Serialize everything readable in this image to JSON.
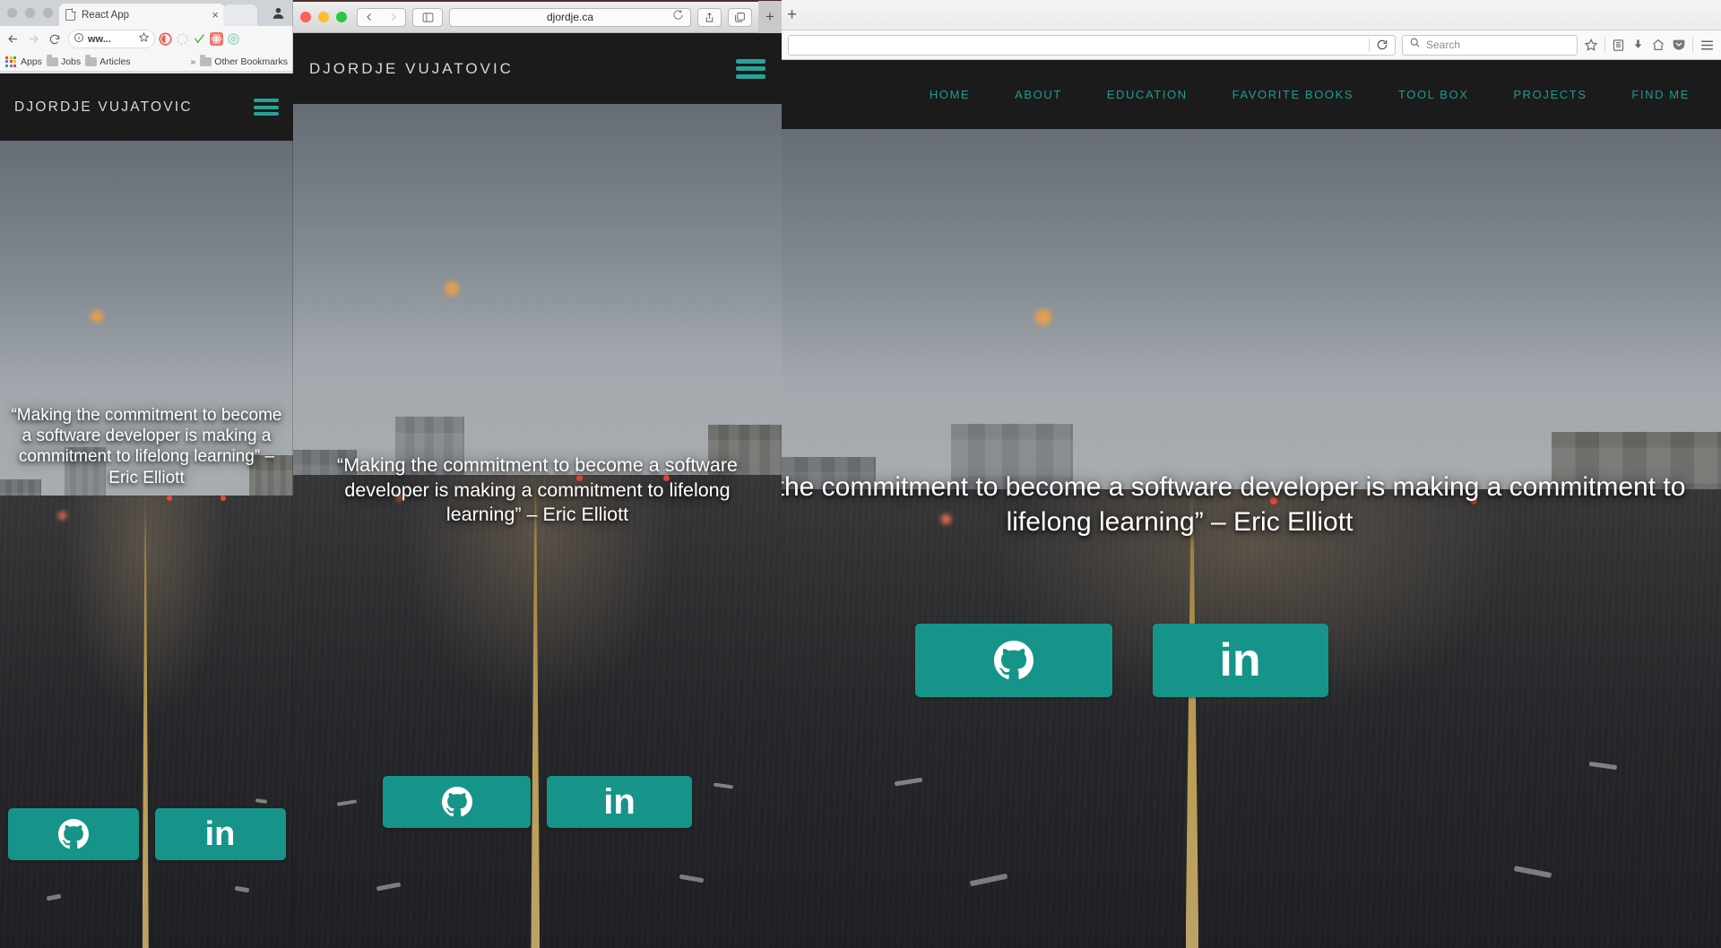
{
  "site": {
    "logo": "DJORDJE VUJATOVIC",
    "menu_icon": "hamburger-menu-icon",
    "accent_color": "#1f9b91",
    "button_color": "#16948a",
    "header_bg": "#1b1b1b",
    "quote": "“Making the commitment to become a software developer is making a commitment to lifelong learning” – Eric Elliott",
    "nav_items": [
      {
        "label": "HOME"
      },
      {
        "label": "ABOUT"
      },
      {
        "label": "EDUCATION"
      },
      {
        "label": "FAVORITE BOOKS"
      },
      {
        "label": "TOOL BOX"
      },
      {
        "label": "PROJECTS"
      },
      {
        "label": "FIND ME"
      }
    ],
    "social": [
      {
        "name": "github-button",
        "icon": "github-icon",
        "label": ""
      },
      {
        "name": "linkedin-button",
        "icon": "linkedin-icon",
        "label": "in"
      }
    ]
  },
  "chrome_window": {
    "tab_title": "React App",
    "tab_close": "×",
    "omnibox_value": "ww...",
    "info_icon": "info-circle-icon",
    "star_icon": "bookmark-star-icon",
    "back_icon": "back-arrow-icon",
    "forward_icon": "forward-arrow-icon",
    "reload_icon": "reload-icon",
    "profile_icon": "profile-avatar-icon",
    "bookmarks": [
      {
        "label": "Apps",
        "icon": "apps-grid-icon"
      },
      {
        "label": "Jobs",
        "icon": "folder-icon"
      },
      {
        "label": "Articles",
        "icon": "folder-icon"
      },
      {
        "label": "»",
        "icon": "overflow-chevron-icon"
      },
      {
        "label": "Other Bookmarks",
        "icon": "folder-icon"
      }
    ],
    "extensions": [
      {
        "name": "ghostery-extension-icon",
        "color": "#ef5a54"
      },
      {
        "name": "loading-extension-icon",
        "color": "#cccccc"
      },
      {
        "name": "grammar-check-extension-icon",
        "color": "#53b153"
      },
      {
        "name": "react-devtools-extension-icon",
        "color": "#e8766d"
      },
      {
        "name": "target-extension-icon",
        "color": "#71d6b6"
      }
    ]
  },
  "safari_window": {
    "url": "djordje.ca",
    "reload_icon": "reload-icon",
    "back_icon": "back-chevron-icon",
    "forward_icon": "forward-chevron-icon",
    "sidebar_icon": "sidebar-toggle-icon",
    "share_icon": "share-icon",
    "tabs_icon": "show-tabs-icon",
    "new_tab_icon": "new-tab-plus-icon",
    "traffic_lights": [
      "#ff5f57",
      "#febc2e",
      "#28c840"
    ]
  },
  "firefox_window": {
    "new_tab_icon": "new-tab-plus-icon",
    "reload_icon": "reload-icon",
    "search_placeholder": "Search",
    "search_icon": "search-magnifier-icon",
    "toolbar_icons": [
      {
        "name": "bookmark-star-icon"
      },
      {
        "name": "library-icon"
      },
      {
        "name": "downloads-icon"
      },
      {
        "name": "home-icon"
      },
      {
        "name": "pocket-save-icon"
      },
      {
        "name": "hamburger-menu-icon"
      }
    ]
  }
}
